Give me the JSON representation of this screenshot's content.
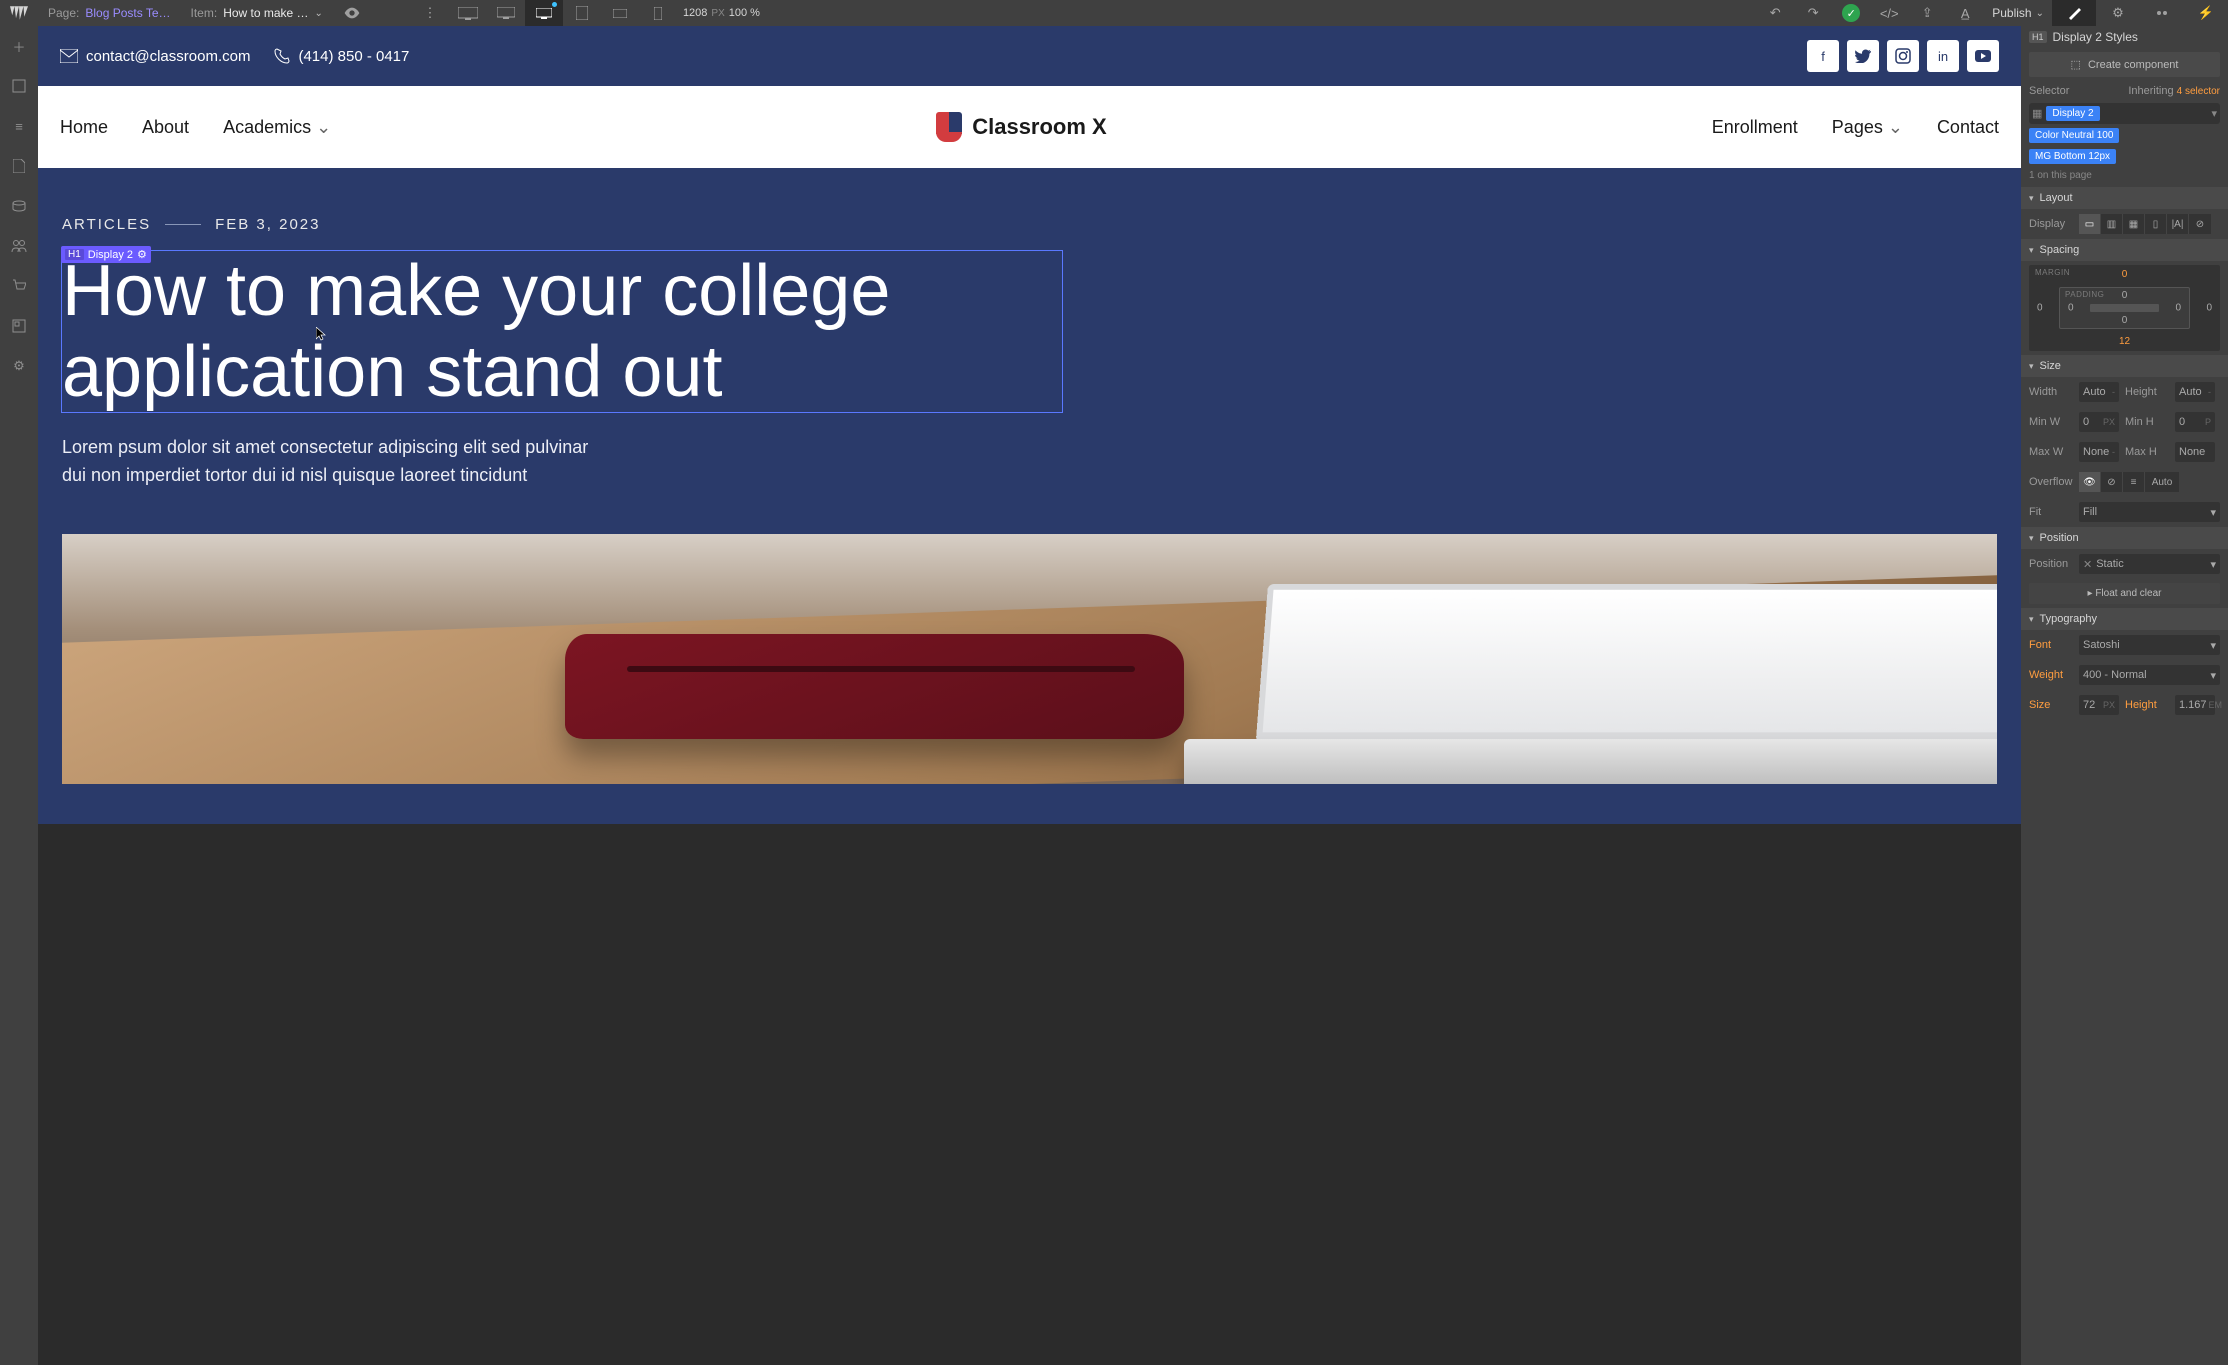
{
  "topbar": {
    "page_label": "Page:",
    "page_name": "Blog Posts Te…",
    "item_label": "Item:",
    "item_name": "How to make …",
    "viewport_width": "1208",
    "viewport_unit": "PX",
    "zoom": "100 %",
    "publish_label": "Publish"
  },
  "left_sidebar": {
    "tools": [
      "add",
      "symbols",
      "navigator",
      "pages",
      "cms",
      "users",
      "ecommerce",
      "assets",
      "settings"
    ]
  },
  "canvas": {
    "announcement": {
      "email": "contact@classroom.com",
      "phone": "(414) 850 - 0417",
      "social": [
        "facebook",
        "twitter",
        "instagram",
        "linkedin",
        "youtube"
      ]
    },
    "nav": {
      "left": [
        "Home",
        "About",
        "Academics"
      ],
      "brand": "Classroom X",
      "right": [
        "Enrollment",
        "Pages",
        "Contact"
      ]
    },
    "hero": {
      "category": "ARTICLES",
      "date": "FEB 3, 2023",
      "selection_tag_el": "H1",
      "selection_tag_class": "Display 2",
      "title": "How to make your college application stand out",
      "sub1": "Lorem psum dolor sit amet consectetur adipiscing elit sed pulvinar",
      "sub2": "dui non imperdiet tortor dui id nisl quisque laoreet tincidunt"
    }
  },
  "style_panel": {
    "heading_tag": "H1",
    "heading_label": "Display 2 Styles",
    "create_component": "Create component",
    "selector_label": "Selector",
    "inheriting_label": "Inheriting",
    "inheriting_count": "4 selector",
    "classes": {
      "primary": "Display 2",
      "extra": [
        "Color Neutral 100",
        "MG Bottom 12px"
      ]
    },
    "on_page": "1 on this page",
    "layout": {
      "section": "Layout",
      "display_label": "Display"
    },
    "spacing": {
      "section": "Spacing",
      "margin_label": "MARGIN",
      "padding_label": "PADDING",
      "m_top": "0",
      "m_right": "0",
      "m_bottom": "12",
      "m_left": "0",
      "p_top": "0",
      "p_right": "0",
      "p_bottom": "0",
      "p_left": "0"
    },
    "size": {
      "section": "Size",
      "width_l": "Width",
      "width_v": "Auto",
      "width_u": "-",
      "height_l": "Height",
      "height_v": "Auto",
      "height_u": "-",
      "minw_l": "Min W",
      "minw_v": "0",
      "minw_u": "PX",
      "minh_l": "Min H",
      "minh_v": "0",
      "minh_u": "P",
      "maxw_l": "Max W",
      "maxw_v": "None",
      "maxw_u": "-",
      "maxh_l": "Max H",
      "maxh_v": "None",
      "maxh_u": "",
      "overflow_l": "Overflow",
      "overflow_auto": "Auto",
      "fit_l": "Fit",
      "fit_v": "Fill"
    },
    "position": {
      "section": "Position",
      "label": "Position",
      "value": "Static",
      "float_label": "Float and clear"
    },
    "typography": {
      "section": "Typography",
      "font_l": "Font",
      "font_v": "Satoshi",
      "weight_l": "Weight",
      "weight_v": "400 - Normal",
      "size_l": "Size",
      "size_v": "72",
      "size_u": "PX",
      "lh_l": "Height",
      "lh_v": "1.167",
      "lh_u": "EM"
    }
  }
}
